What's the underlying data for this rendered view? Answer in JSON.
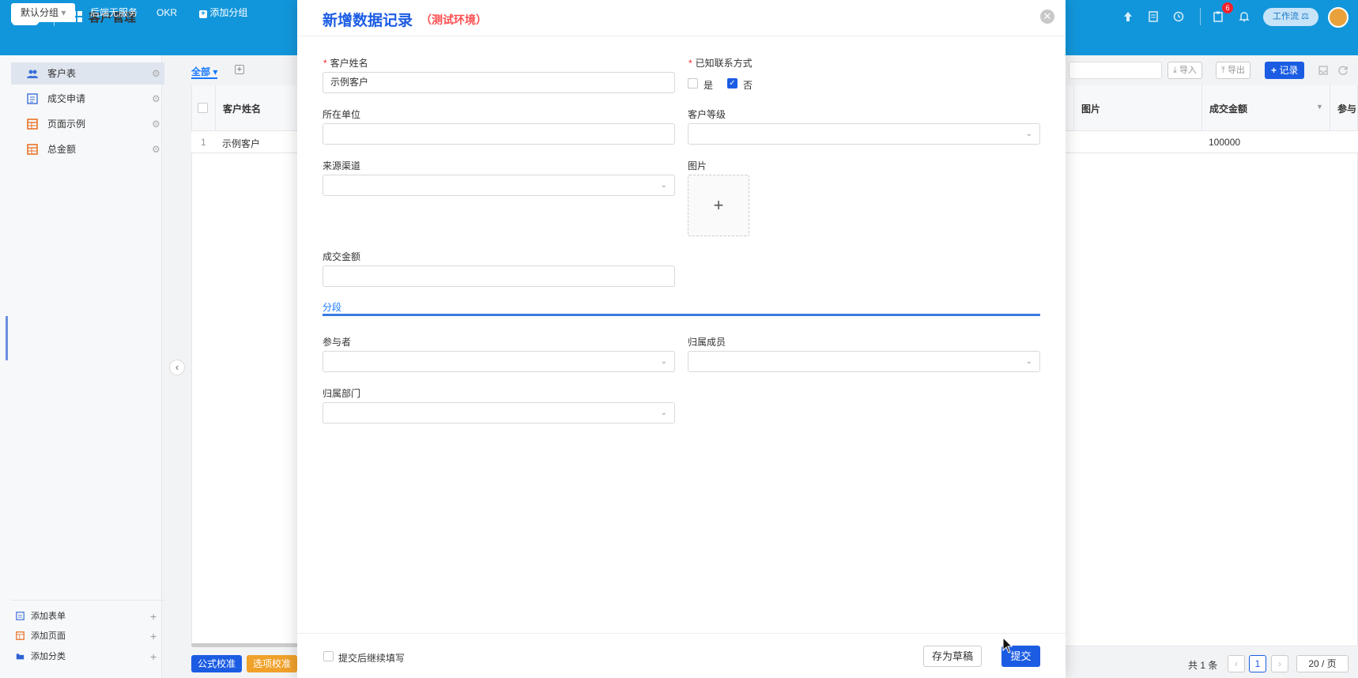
{
  "app": {
    "title": "客户管理",
    "brand_color": "#1296db"
  },
  "group_tabs": [
    {
      "label": "默认分组",
      "active": true,
      "caret": "▾"
    },
    {
      "label": "后端无服务"
    },
    {
      "label": "OKR"
    },
    {
      "label": "添加分组",
      "icon": "plus-square-icon"
    }
  ],
  "header": {
    "notification_badge": "6",
    "workflow_label": "工作流",
    "workflow_glyph": "⚖"
  },
  "sidebar": {
    "items": [
      {
        "label": "客户表",
        "icon": "users-icon",
        "active": true
      },
      {
        "label": "成交申请",
        "icon": "form-icon"
      },
      {
        "label": "页面示例",
        "icon": "table-icon"
      },
      {
        "label": "总金额",
        "icon": "table-icon"
      }
    ],
    "bottom": [
      {
        "label": "添加表单",
        "icon": "form-icon"
      },
      {
        "label": "添加页面",
        "icon": "table-icon"
      },
      {
        "label": "添加分类",
        "icon": "folder-icon"
      }
    ],
    "collapse_glyph": "‹",
    "gear_glyph": "⚙"
  },
  "view": {
    "tab_label": "全部",
    "caret": "▾",
    "add_glyph": "+"
  },
  "toolbar": {
    "import_label": "导入",
    "export_label": "导出",
    "record_label": "记录"
  },
  "table": {
    "columns": {
      "name": "客户姓名",
      "image": "图片",
      "amount": "成交金额",
      "participants": "参与"
    },
    "rows": [
      {
        "index": "1",
        "name": "示例客户",
        "amount": "100000"
      }
    ]
  },
  "bottom_buttons": {
    "formula": "公式校准",
    "option": "选项校准"
  },
  "pager": {
    "total": "共 1 条",
    "current": "1",
    "page_size": "20 / 页",
    "prev": "‹",
    "next": "›"
  },
  "modal": {
    "title": "新增数据记录",
    "subtitle": "（测试环境）",
    "close_glyph": "✕",
    "required_mark": "*",
    "fields": {
      "customer_name": {
        "label": "客户姓名",
        "value": "示例客户"
      },
      "contact_known": {
        "label": "已知联系方式",
        "options": [
          {
            "label": "是",
            "checked": false
          },
          {
            "label": "否",
            "checked": true
          }
        ]
      },
      "company": {
        "label": "所在单位",
        "value": ""
      },
      "customer_level": {
        "label": "客户等级",
        "value": ""
      },
      "source": {
        "label": "来源渠道",
        "value": ""
      },
      "image": {
        "label": "图片",
        "upload_glyph": "+"
      },
      "amount": {
        "label": "成交金额",
        "value": ""
      },
      "participants": {
        "label": "参与者",
        "value": ""
      },
      "owner": {
        "label": "归属成员",
        "value": ""
      },
      "department": {
        "label": "归属部门",
        "value": ""
      }
    },
    "section_label": "分段",
    "chevron_glyph": "⌄",
    "check_glyph": "✓",
    "footer": {
      "continue_label": "提交后继续填写",
      "draft_label": "存为草稿",
      "submit_label": "提交"
    }
  }
}
